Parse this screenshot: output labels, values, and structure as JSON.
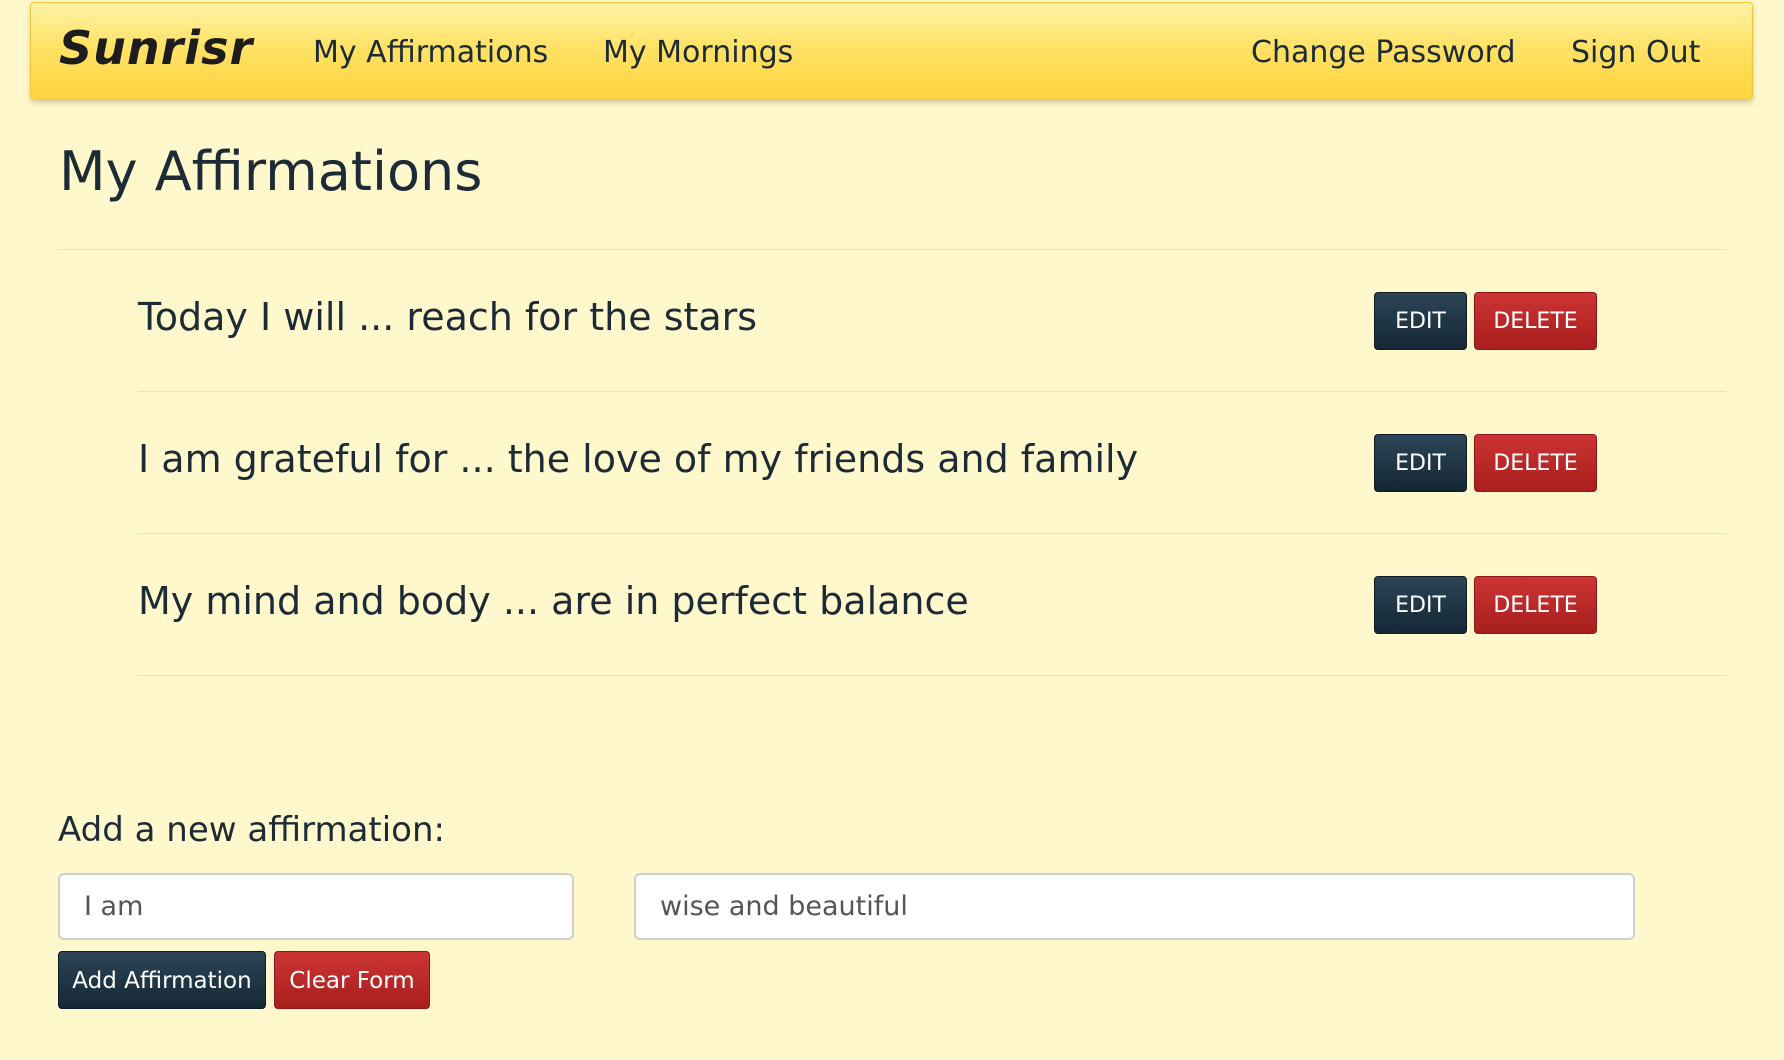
{
  "navbar": {
    "brand": "Sunrisr",
    "links": {
      "affirmations": "My Affirmations",
      "mornings": "My Mornings",
      "change_password": "Change Password",
      "sign_out": "Sign Out"
    }
  },
  "page": {
    "title": "My Affirmations"
  },
  "affirmations": [
    {
      "text": "Today I will ... reach for the stars",
      "edit_label": "EDIT",
      "delete_label": "DELETE"
    },
    {
      "text": "I am grateful for ... the love of my friends and family",
      "edit_label": "EDIT",
      "delete_label": "DELETE"
    },
    {
      "text": "My mind and body ... are in perfect balance",
      "edit_label": "EDIT",
      "delete_label": "DELETE"
    }
  ],
  "form": {
    "label": "Add a new affirmation:",
    "prefix_value": "I am",
    "body_value": "wise and beautiful",
    "add_label": "Add Affirmation",
    "clear_label": "Clear Form"
  },
  "colors": {
    "background": "#fff8cc",
    "navbar": "#ffd43f",
    "primary_button": "#1c3242",
    "danger_button": "#b82626",
    "text": "#1c2b36"
  }
}
